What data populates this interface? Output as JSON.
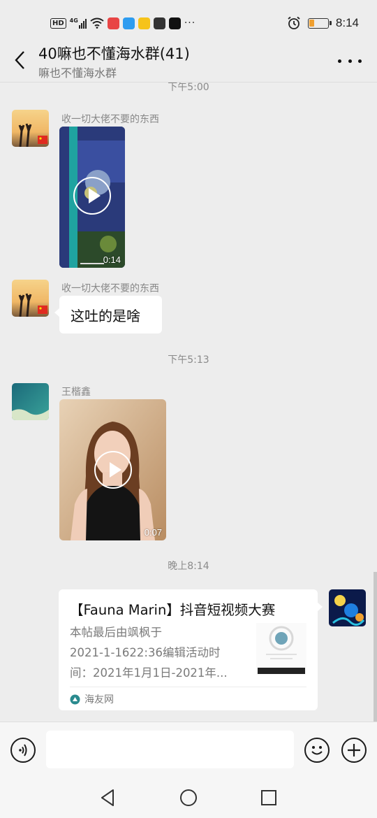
{
  "status_bar": {
    "left_badges": [
      "HD",
      "4G"
    ],
    "time": "8:14",
    "battery_level": 0.3,
    "icons": [
      "hd-icon",
      "signal-icon",
      "wifi-icon",
      "app-notification-icons",
      "more-dots",
      "alarm-icon",
      "battery-icon"
    ]
  },
  "header": {
    "title": "40嘛也不懂海水群(41)",
    "subtitle": "嘛也不懂海水群",
    "back_icon": "chevron-left-icon",
    "more_icon": "more-horizontal-icon"
  },
  "messages": [
    {
      "type": "time",
      "text": "下午5:00"
    },
    {
      "type": "video",
      "sender": "收一切大佬不要的东西",
      "duration": "0:14"
    },
    {
      "type": "text",
      "sender": "收一切大佬不要的东西",
      "text": "这吐的是啥"
    },
    {
      "type": "time",
      "text": "下午5:13"
    },
    {
      "type": "video",
      "sender": "王楷鑫",
      "duration": "0:07"
    },
    {
      "type": "time",
      "text": "晚上8:14"
    },
    {
      "type": "link_card",
      "sender": "self",
      "title": "【Fauna Marin】抖音短视频大赛",
      "description_lines": [
        "本帖最后由飒枫于",
        "2021-1-1622:36编辑活动时",
        "间：2021年1月1日-2021年..."
      ],
      "source": "海友网"
    }
  ],
  "input_bar": {
    "voice_icon": "voice-input-icon",
    "placeholder": "",
    "emoji_icon": "emoji-icon",
    "plus_icon": "plus-icon"
  },
  "system_nav": [
    "back-triangle-icon",
    "home-circle-icon",
    "recents-square-icon"
  ],
  "colors": {
    "background": "#ededed",
    "bubble": "#ffffff",
    "battery": "#f0a030",
    "text_secondary": "#8a8a8a"
  }
}
